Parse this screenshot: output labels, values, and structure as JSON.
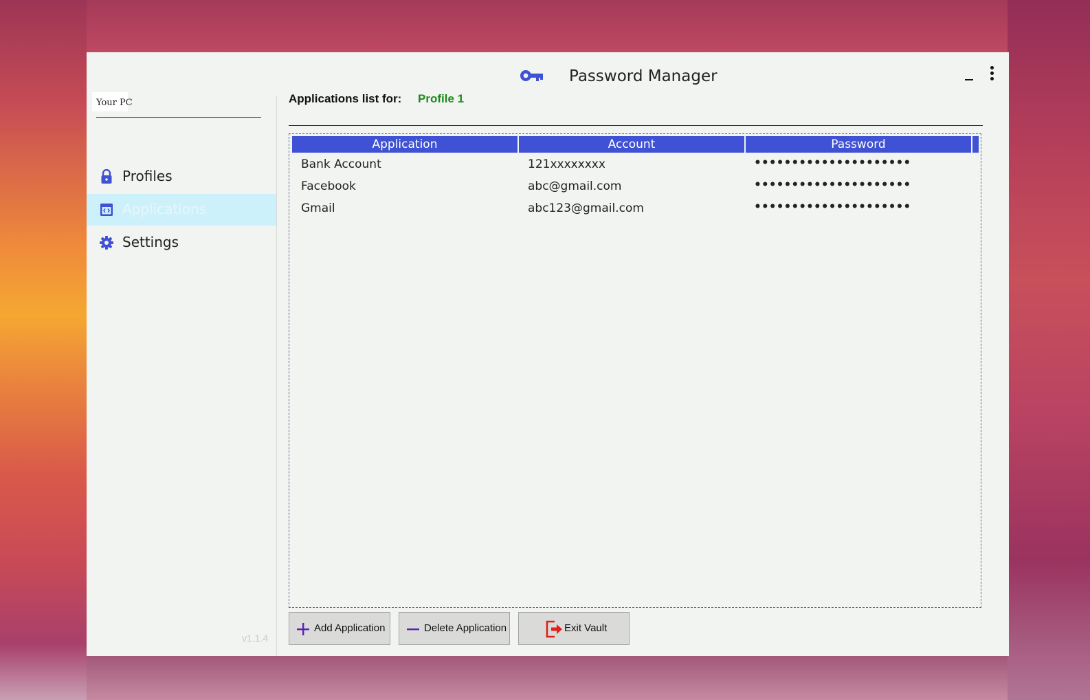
{
  "window": {
    "title": "Password Manager",
    "app_icon": "key-icon",
    "version": "v1.1.4"
  },
  "sidebar": {
    "pc_label": "Your PC",
    "items": [
      {
        "label": "Profiles",
        "icon": "lock-icon",
        "active": false
      },
      {
        "label": "Applications",
        "icon": "app-window-icon",
        "active": true
      },
      {
        "label": "Settings",
        "icon": "gear-icon",
        "active": false
      }
    ]
  },
  "main": {
    "heading": "Applications list for:",
    "profile_name": "Profile 1",
    "columns": [
      "Application",
      "Account",
      "Password"
    ],
    "rows": [
      {
        "application": "Bank Account",
        "account": "121xxxxxxxx",
        "password": "•••••••••••••••••••••"
      },
      {
        "application": "Facebook",
        "account": "abc@gmail.com",
        "password": "•••••••••••••••••••••"
      },
      {
        "application": "Gmail",
        "account": "abc123@gmail.com",
        "password": "•••••••••••••••••••••"
      }
    ]
  },
  "actions": {
    "add_label": "Add Application",
    "delete_label": "Delete Application",
    "exit_label": "Exit Vault"
  },
  "colors": {
    "accent": "#3f51d4",
    "profile_green": "#1d8a1d",
    "active_nav_bg": "#cdf1fb",
    "exit_red": "#e0201a",
    "add_purple": "#5a1fb4"
  }
}
